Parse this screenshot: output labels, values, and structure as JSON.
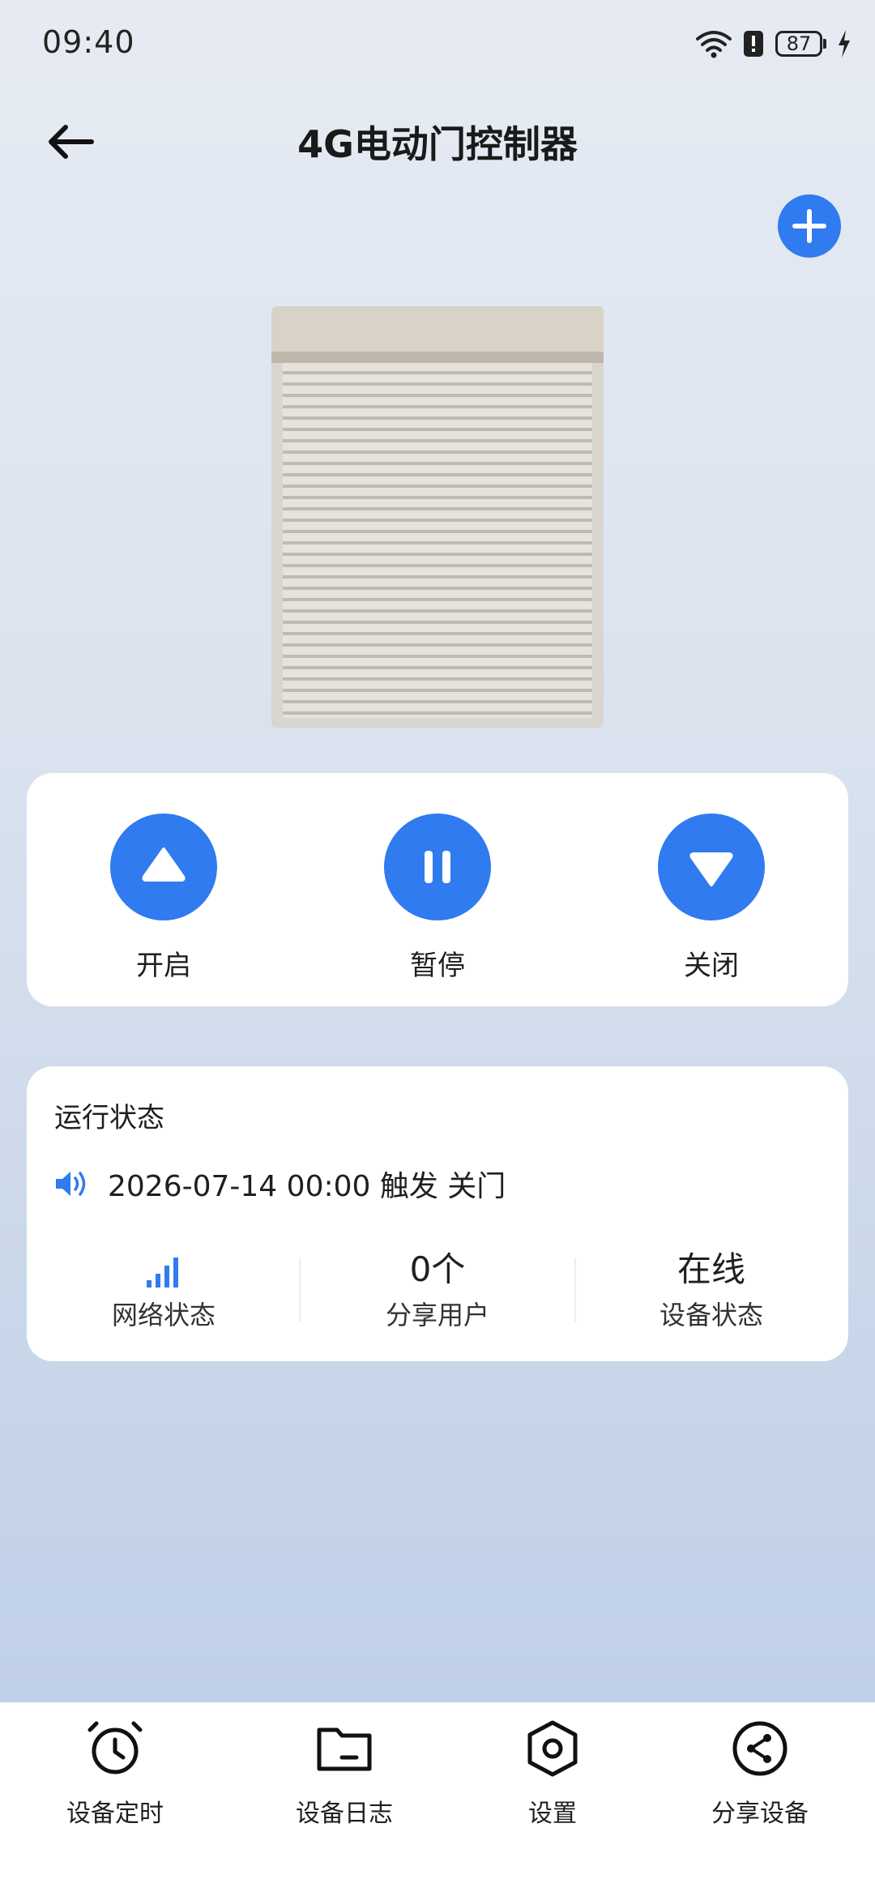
{
  "status_bar": {
    "time": "09:40",
    "battery": "87"
  },
  "header": {
    "title": "4G电动门控制器"
  },
  "controls": {
    "open_label": "开启",
    "pause_label": "暂停",
    "close_label": "关闭"
  },
  "status": {
    "title": "运行状态",
    "event": "2026-07-14 00:00 触发 关门",
    "network_label": "网络状态",
    "share_value": "0个",
    "share_label": "分享用户",
    "device_value": "在线",
    "device_label": "设备状态"
  },
  "nav": {
    "items": [
      {
        "label": "设备定时",
        "icon": "alarm-clock-icon"
      },
      {
        "label": "设备日志",
        "icon": "folder-icon"
      },
      {
        "label": "设置",
        "icon": "hexagon-settings-icon"
      },
      {
        "label": "分享设备",
        "icon": "share-icon"
      }
    ]
  },
  "colors": {
    "accent": "#2f7bef"
  }
}
